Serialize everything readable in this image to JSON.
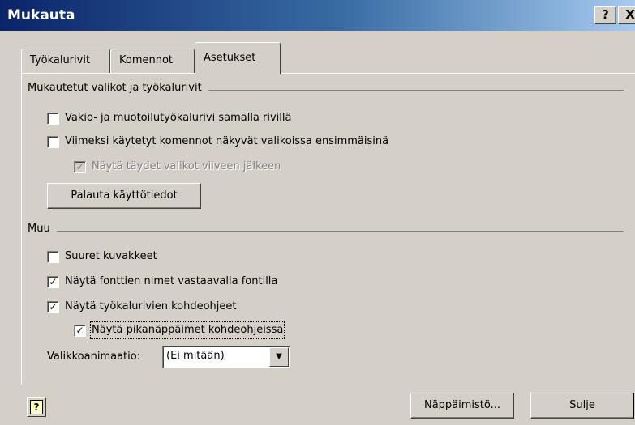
{
  "window": {
    "title": "Mukauta",
    "help_button": "?",
    "close_button": "X"
  },
  "tabs": [
    {
      "label": "Työkalurivit",
      "active": false
    },
    {
      "label": "Komennot",
      "active": false
    },
    {
      "label": "Asetukset",
      "active": true
    }
  ],
  "group_custom": {
    "title": "Mukautetut valikot ja työkalurivit",
    "options": [
      {
        "label": "Vakio- ja muotoilutyökalurivi samalla rivillä",
        "checked": false,
        "enabled": true
      },
      {
        "label": "Viimeksi käytetyt komennot näkyvät valikoissa ensimmäisinä",
        "checked": false,
        "enabled": true
      },
      {
        "label": "Näytä täydet valikot viiveen jälkeen",
        "checked": true,
        "enabled": false
      }
    ],
    "reset_button": "Palauta käyttötiedot"
  },
  "group_other": {
    "title": "Muu",
    "options": [
      {
        "label": "Suuret kuvakkeet",
        "checked": false,
        "enabled": true
      },
      {
        "label": "Näytä fonttien nimet vastaavalla fontilla",
        "checked": true,
        "enabled": true
      },
      {
        "label": "Näytä työkalurivien kohdeohjeet",
        "checked": true,
        "enabled": true
      },
      {
        "label": "Näytä pikanäppäimet kohdeohjeissa",
        "checked": true,
        "enabled": true
      }
    ],
    "animation_label": "Valikkoanimaatio:",
    "animation_value": "(Ei mitään)"
  },
  "footer": {
    "help_icon": "?",
    "keyboard_button": "Näppäimistö...",
    "close_button": "Sulje"
  }
}
